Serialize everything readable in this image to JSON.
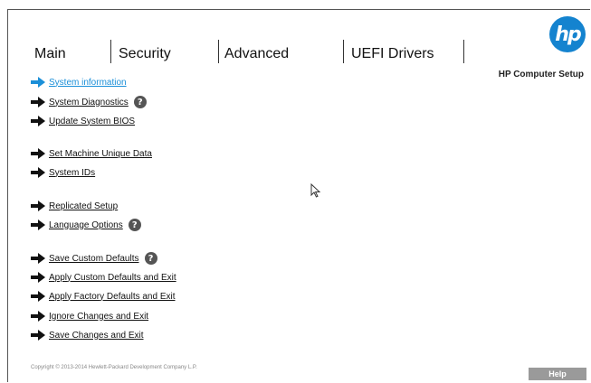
{
  "tabs": [
    "Main",
    "Security",
    "Advanced",
    "UEFI Drivers"
  ],
  "logo_text": "hp",
  "app_title": "HP Computer Setup",
  "menu_items": [
    {
      "label": "System information",
      "active": true,
      "help": false
    },
    {
      "label": "System Diagnostics",
      "active": false,
      "help": true
    },
    {
      "label": "Update System BIOS",
      "active": false,
      "help": false
    },
    {
      "label": "Set Machine Unique Data",
      "active": false,
      "help": false
    },
    {
      "label": "System IDs",
      "active": false,
      "help": false
    },
    {
      "label": "Replicated Setup",
      "active": false,
      "help": false
    },
    {
      "label": "Language Options",
      "active": false,
      "help": true
    },
    {
      "label": "Save Custom Defaults",
      "active": false,
      "help": true
    },
    {
      "label": "Apply Custom Defaults and Exit",
      "active": false,
      "help": false
    },
    {
      "label": "Apply Factory Defaults and Exit",
      "active": false,
      "help": false
    },
    {
      "label": "Ignore Changes and Exit",
      "active": false,
      "help": false
    },
    {
      "label": "Save Changes and Exit",
      "active": false,
      "help": false
    }
  ],
  "help_glyph": "?",
  "copyright": "Copyright © 2013-2014 Hewlett-Packard Development Company L.P.",
  "help_button": "Help",
  "colors": {
    "accent": "#1b8fd8",
    "logo": "#1483cf",
    "arrow": "#111111"
  }
}
